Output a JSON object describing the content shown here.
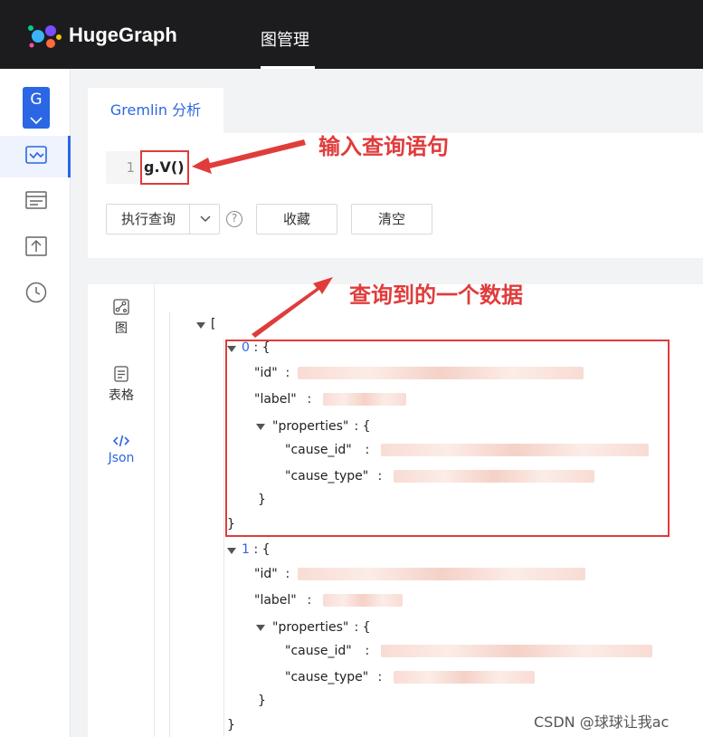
{
  "header": {
    "brand": "HugeGraph",
    "nav_item": "图管理"
  },
  "sidebar": {
    "graph_selector": "G"
  },
  "query": {
    "tab_label": "Gremlin 分析",
    "line_number": "1",
    "code": "g.V()",
    "execute_label": "执行查询",
    "favorite_label": "收藏",
    "clear_label": "清空",
    "help_glyph": "?"
  },
  "results": {
    "tabs": [
      {
        "label": "图",
        "icon": "graph-icon"
      },
      {
        "label": "表格",
        "icon": "table-icon"
      },
      {
        "label": "Json",
        "icon": "code-icon"
      }
    ],
    "json_lines": {
      "open_bracket": "[",
      "close_bracket": "}",
      "item0_index": "0",
      "item1_index": "1",
      "sep_open": " : {",
      "id_key": "\"id\"",
      "label_key": "\"label\"",
      "properties_key": "\"properties\"",
      "cause_id_key": "\"cause_id\"",
      "cause_type_key": "\"cause_type\"",
      "colon": " : ",
      "close_brace": "}"
    }
  },
  "annotations": {
    "query_note": "输入查询语句",
    "result_note": "查询到的一个数据",
    "color": "#e03c3c"
  },
  "watermark": "CSDN @球球让我ac",
  "colors": {
    "accent": "#2b66e4",
    "topbar": "#1c1c1f"
  }
}
